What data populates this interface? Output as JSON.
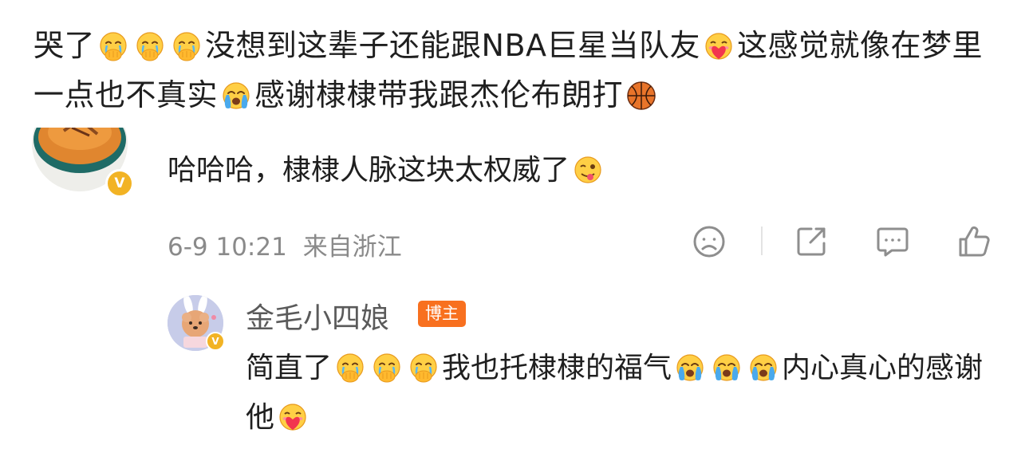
{
  "comment": {
    "segments": [
      {
        "text": "哭了"
      },
      {
        "emoji": "crying-pray-emoji"
      },
      {
        "emoji": "crying-pray-emoji"
      },
      {
        "emoji": "crying-pray-emoji"
      },
      {
        "text": "没想到这辈子还能跟NBA巨星当队友"
      },
      {
        "emoji": "heart-kiss-emoji"
      },
      {
        "text": "这感觉就像在梦里 一点也不真实"
      },
      {
        "emoji": "tears-of-joy-emoji"
      },
      {
        "text": "感谢棣棣带我跟杰伦布朗打"
      },
      {
        "emoji": "basketball-emoji"
      }
    ]
  },
  "reply": {
    "segments": [
      {
        "text": "哈哈哈，棣棣人脉这块太权威了"
      },
      {
        "emoji": "tongue-wink-emoji"
      }
    ],
    "timestamp": "6-9 10:21",
    "location": "来自浙江",
    "badge_letter": "V",
    "actions": [
      "sad-face-icon",
      "share-icon",
      "comment-icon",
      "like-icon"
    ]
  },
  "author_reply": {
    "name": "金毛小四娘",
    "badge": "博主",
    "badge_color": "#f8701f",
    "segments": [
      {
        "text": "简直了"
      },
      {
        "emoji": "crying-pray-emoji"
      },
      {
        "emoji": "crying-pray-emoji"
      },
      {
        "emoji": "crying-pray-emoji"
      },
      {
        "text": "我也托棣棣的福气"
      },
      {
        "emoji": "tears-of-joy-emoji"
      },
      {
        "emoji": "tears-of-joy-emoji"
      },
      {
        "emoji": "tears-of-joy-emoji"
      },
      {
        "text": "内心真心的感谢他"
      },
      {
        "emoji": "heart-kiss-emoji"
      }
    ]
  },
  "colors": {
    "verified_badge": "#f2b324",
    "meta_text": "#8a8a8a",
    "icon_stroke": "#8e8e8e"
  }
}
